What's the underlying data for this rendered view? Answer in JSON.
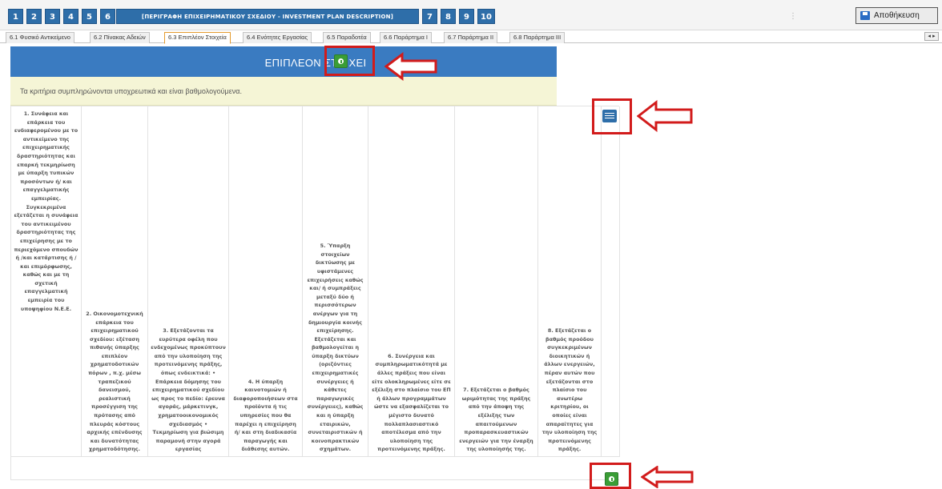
{
  "toolbar": {
    "steps": [
      "1",
      "2",
      "3",
      "4",
      "5",
      "6"
    ],
    "step6_label": "[ΠΕΡΙΓΡΑΦΗ ΕΠΙΧΕΙΡΗΜΑΤΙΚΟΥ ΣΧΕΔΙΟΥ - INVESTMENT PLAN DESCRIPTION]",
    "steps_after": [
      "7",
      "8",
      "9",
      "10"
    ],
    "separator": "⋮",
    "save_label": "Αποθήκευση"
  },
  "tabs": [
    {
      "label": "6.1 Φυσικό Αντικείμενο",
      "active": false
    },
    {
      "label": "6.2 Πίνακας Αδειών",
      "active": false
    },
    {
      "label": "6.3 Επιπλέον Στοιχεία",
      "active": true
    },
    {
      "label": "6.4 Ενότητες Εργασίας",
      "active": false
    },
    {
      "label": "6.5 Παραδοτέα",
      "active": false
    },
    {
      "label": "6.6 Παράρτημα I",
      "active": false
    },
    {
      "label": "6.7 Παράρτημα II",
      "active": false
    },
    {
      "label": "6.8 Παράρτημα III",
      "active": false
    }
  ],
  "tab_scroll": "◂ ▸",
  "panel": {
    "title": "ΕΠΙΠΛΕΟΝ ΣΤΟΙΧΕΙ",
    "notice": "Τα κριτήρια συμπληρώνονται υποχρεωτικά και είναι βαθμολογούμενα."
  },
  "criteria": [
    "1. Συνάφεια και επάρκεια του ενδιαφερομένου με το αντικείμενο της επιχειρηματικής δραστηριότητας και επαρκή τεκμηρίωση με ύπαρξη τυπικών προσόντων ή/ και επαγγελματικής εμπειρίας. Συγκεκριμένα εξετάζεται η συνάφεια του αντικειμένου δραστηριότητας της επιχείρησης με το περιεχόμενο σπουδών ή /και κατάρτισης ή / και επιμόρφωσης, καθώς και με τη σχετική επαγγελματική εμπειρία του υποψηφίου Ν.Ε.Ε.",
    "2. Οικονομοτεχνική επάρκεια του επιχειρηματικού σχεδίου: εξέταση πιθανής ύπαρξης επιπλέον χρηματοδοτικών πόρων , π.χ. μέσω τραπεζικού δανεισμού, ρεαλιστική προσέγγιση της πρότασης από πλευράς κόστους αρχικής επένδυσης και δυνατότητας χρηματοδότησης.",
    "3. Εξετάζονται τα ευρύτερα οφέλη που ενδεχομένως προκύπτουν από την υλοποίηση της προτεινόμενης πράξης, όπως ενδεικτικά: • Επάρκεια δόμησης του επιχειρηματικού σχεδίου ως προς το πεδίο: έρευνα αγοράς, μάρκετινγκ, χρηματοοικονομικός σχεδιασμός • Τεκμηρίωση για βιώσιμη παραμονή στην αγορά εργασίας",
    "4. Η ύπαρξη καινοτομιών ή διαφοροποιήσεων στα προϊόντα ή τις υπηρεσίες που θα παρέχει η επιχείρηση ή/ και στη διαδικασία παραγωγής και διάθεσης αυτών.",
    "5. Ύπαρξη στοιχείων δικτύωσης με υφιστάμενες επιχειρήσεις καθώς και/ ή συμπράξεις μεταξύ δύο ή περισσότερων ανέργων για τη δημιουργία κοινής επιχείρησης. Εξετάζεται και βαθμολογείται η ύπαρξη δικτύων (οριζόντιες επιχειρηματικές συνέργειες ή κάθετες παραγωγικές συνέργειες), καθώς και η ύπαρξη εταιρικών, συνεταιριστικών ή κοινοπρακτικών σχημάτων.",
    "6. Συνέργεια και συμπληρωματικότητά με άλλες πράξεις που είναι είτε ολοκληρωμένες είτε σε εξέλιξη στο πλαίσιο του ΕΠ ή άλλων προγραμμάτων ώστε να εξασφαλίζεται το μέγιστο δυνατό πολλαπλασιαστικό αποτέλεσμα από την υλοποίηση της προτεινόμενης πράξης.",
    "7. Εξετάζεται ο βαθμός ωριμότητας της πράξης από την άποψη της εξέλιξης των απαιτούμενων προπαρασκευαστικών ενεργειών για την έναρξη της υλοποίησής της.",
    "8. Εξετάζεται ο βαθμός προόδου συγκεκριμένων διοικητικών ή άλλων ενεργειών, πέραν αυτών που εξετάζονται στο πλαίσιο του ανωτέρω κριτηρίου, οι οποίες είναι απαραίτητες για την υλοποίηση της προτεινόμενης πράξης."
  ],
  "colors": {
    "step_blue": "#2e6ea9",
    "header_blue": "#3a7bc1",
    "notice_bg": "#f5f5d6",
    "add_green": "#3a9d36",
    "annotation_red": "#d21b1b"
  },
  "icons": {
    "save": "floppy-disk-icon",
    "add": "plus-circle-icon",
    "table": "table-list-icon",
    "annotation_arrow": "left-arrow-icon"
  }
}
